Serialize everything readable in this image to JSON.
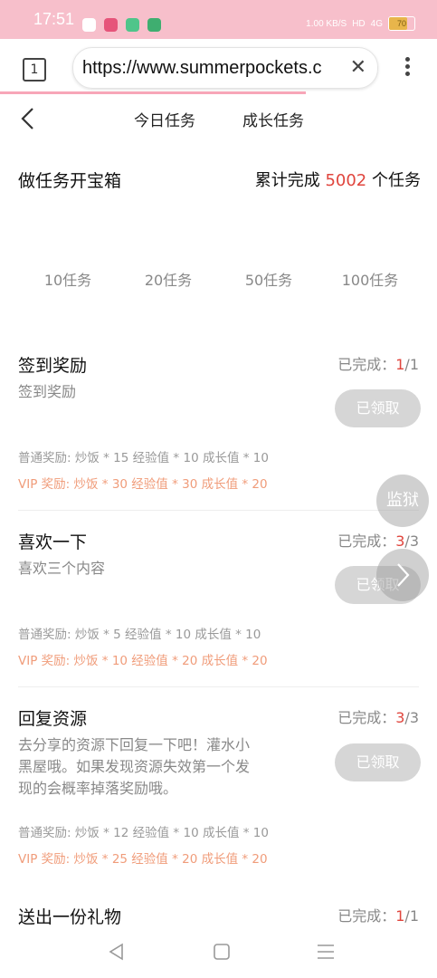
{
  "status_bar": {
    "time": "17:51",
    "net_speed": "1.00 KB/S",
    "hd": "HD",
    "signal": "4G",
    "battery": "70"
  },
  "browser": {
    "tab_count": "1",
    "url": "https://www.summerpockets.c",
    "clear_icon": "close-icon",
    "menu_icon": "more-vert-icon",
    "page_progress": 0.7
  },
  "nav": {
    "back_icon": "chevron-left-icon",
    "tabs": [
      {
        "label": "今日任务"
      },
      {
        "label": "成长任务"
      }
    ]
  },
  "chest": {
    "title": "做任务开宝箱",
    "total_prefix": "累计完成",
    "total_count": "5002",
    "total_suffix": "个任务",
    "milestones": [
      "10任务",
      "20任务",
      "50任务",
      "100任务"
    ]
  },
  "tasks": [
    {
      "title": "签到奖励",
      "status_label": "已完成：",
      "done": "1",
      "total": "/1",
      "desc": "签到奖励",
      "button": "已领取",
      "normal_reward": "普通奖励:  炒饭 * 15  经验值 * 10  成长值 * 10",
      "vip_reward": "VIP 奖励:  炒饭 * 30  经验值 * 30  成长值 * 20"
    },
    {
      "title": "喜欢一下",
      "status_label": "已完成：",
      "done": "3",
      "total": "/3",
      "desc": "喜欢三个内容",
      "button": "已领取",
      "normal_reward": "普通奖励:  炒饭 * 5  经验值 * 10  成长值 * 10",
      "vip_reward": "VIP 奖励:  炒饭 * 10  经验值 * 20  成长值 * 20"
    },
    {
      "title": "回复资源",
      "status_label": "已完成：",
      "done": "3",
      "total": "/3",
      "desc": "去分享的资源下回复一下吧！灌水小黑屋哦。如果发现资源失效第一个发现的会概率掉落奖励哦。",
      "button": "已领取",
      "normal_reward": "普通奖励:  炒饭 * 12  经验值 * 10  成长值 * 10",
      "vip_reward": "VIP 奖励:  炒饭 * 25  经验值 * 20  成长值 * 20"
    },
    {
      "title": "送出一份礼物",
      "status_label": "已完成：",
      "done": "1",
      "total": "/1"
    }
  ],
  "floating": {
    "jail_label": "监狱",
    "next_icon": "chevron-right-icon"
  },
  "system_nav": {
    "back": "triangle-back-icon",
    "home": "square-home-icon",
    "menu": "menu-lines-icon"
  },
  "colors": {
    "accent_red": "#e0453d",
    "vip_orange": "#f09c7a",
    "status_pink": "#f7bfcb",
    "button_gray": "#d6d6d6"
  }
}
